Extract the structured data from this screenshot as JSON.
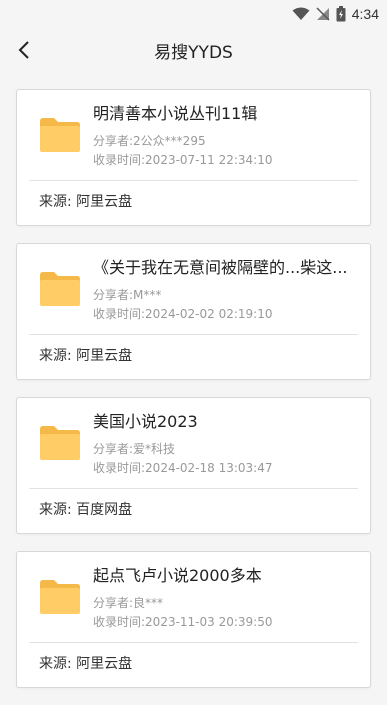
{
  "status": {
    "time": "4:34"
  },
  "header": {
    "title": "易搜YYDS"
  },
  "items": [
    {
      "title": "明清善本小说丛刊11辑",
      "sharer": "分享者:2公众***295",
      "time": "收录时间:2023-07-11 22:34:10",
      "source": "来源:  阿里云盘"
    },
    {
      "title": "《关于我在无意间被隔壁的...柴这...",
      "sharer": "分享者:M***",
      "time": "收录时间:2024-02-02 02:19:10",
      "source": "来源:  阿里云盘"
    },
    {
      "title": "美国小说2023",
      "sharer": "分享者:爱*科技",
      "time": "收录时间:2024-02-18 13:03:47",
      "source": "来源:  百度网盘"
    },
    {
      "title": "起点飞卢小说2000多本",
      "sharer": "分享者:良***",
      "time": "收录时间:2023-11-03 20:39:50",
      "source": "来源:  阿里云盘"
    }
  ],
  "colors": {
    "folder": "#ffcc66",
    "folder_dark": "#f5b94a",
    "background": "#f5f5f5"
  }
}
